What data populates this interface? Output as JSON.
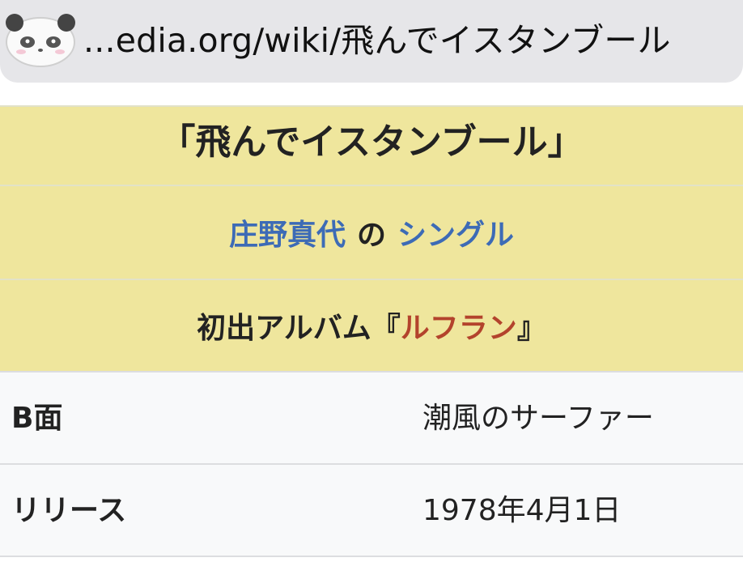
{
  "browser": {
    "url_display": "...edia.org/wiki/飛んでイスタンブール",
    "favicon": "panda-icon"
  },
  "infobox": {
    "title": "「飛んでイスタンブール」",
    "artist": "庄野真代",
    "artist_connector": "の",
    "type": "シングル",
    "album_prefix": "初出アルバム『",
    "album": "ルフラン",
    "album_suffix": "』",
    "rows": [
      {
        "label": "B面",
        "value": "潮風のサーファー"
      },
      {
        "label": "リリース",
        "value": "1978年4月1日"
      }
    ]
  },
  "colors": {
    "header_bg": "#efe69d",
    "link": "#3d6bb6",
    "link_red": "#b3432c",
    "row_bg": "#f8f9fa"
  }
}
